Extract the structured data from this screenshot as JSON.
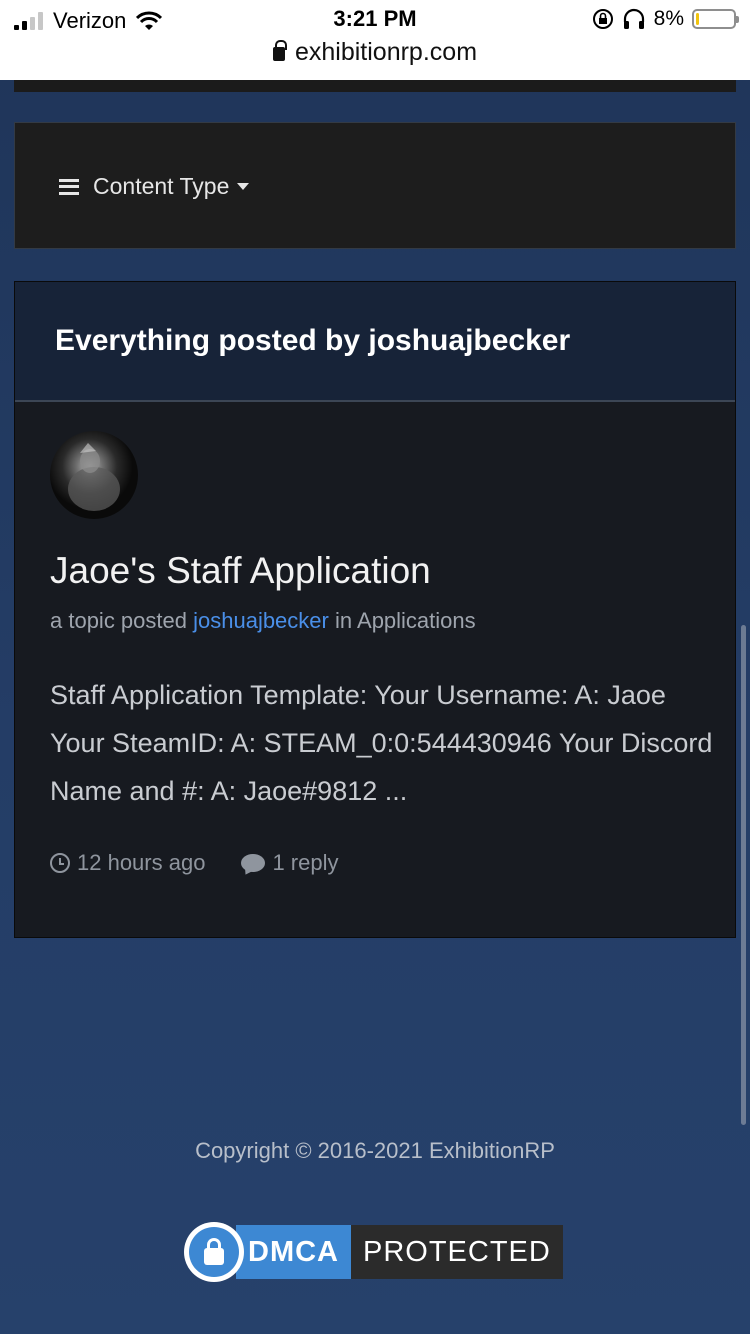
{
  "status_bar": {
    "carrier": "Verizon",
    "time": "3:21 PM",
    "battery_percent": "8%",
    "battery_level": 0.08,
    "url": "exhibitionrp.com"
  },
  "filter": {
    "content_type_label": "Content Type"
  },
  "results": {
    "title": "Everything posted by joshuajbecker",
    "items": [
      {
        "title": "Jaoe's Staff Application",
        "meta_prefix": "a topic posted",
        "author": "joshuajbecker",
        "meta_in": "in",
        "forum": "Applications",
        "snippet": "Staff Application Template: Your Username: A: Jaoe Your SteamID: A: STEAM_0:0:544430946 Your Discord Name and #: A: Jaoe#9812 ...",
        "time": "12 hours ago",
        "replies": "1 reply"
      }
    ]
  },
  "footer": {
    "copyright": "Copyright © 2016-2021 ExhibitionRP",
    "dmca_left": "DMCA",
    "dmca_right": "PROTECTED"
  },
  "colors": {
    "background": "#243d66",
    "link": "#4a8fe8",
    "dmca_blue": "#3d88d3"
  }
}
